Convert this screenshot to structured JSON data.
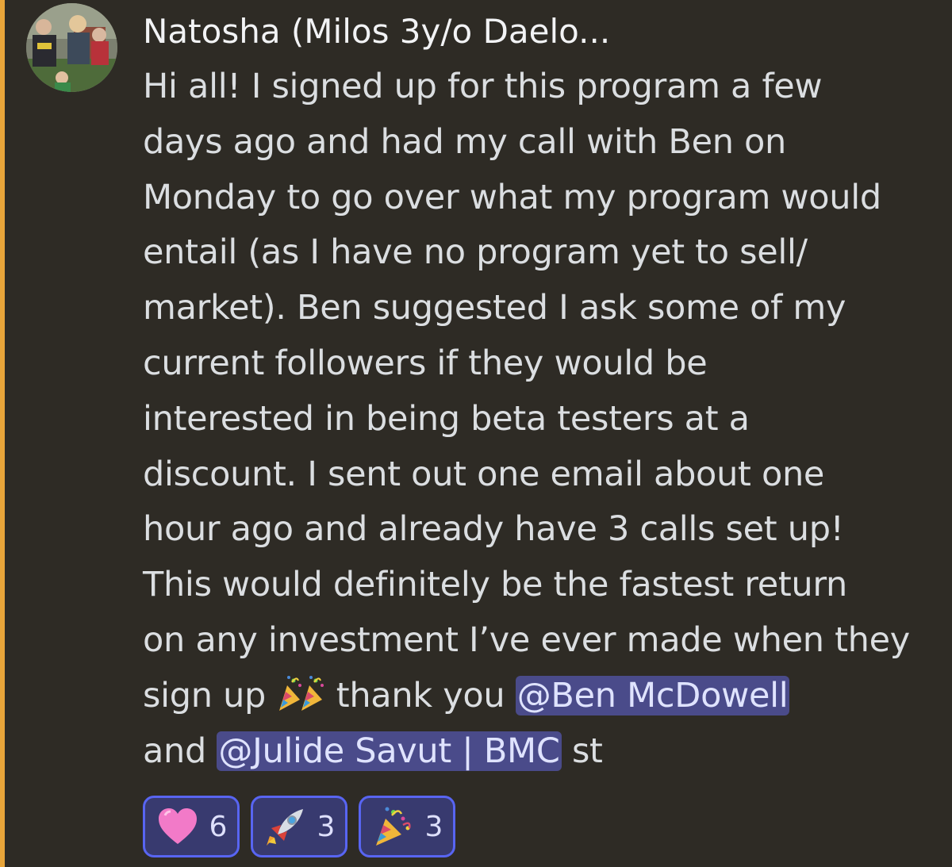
{
  "message": {
    "author": "Natosha (Milos 3y/o Daelo...",
    "lines": [
      "Hi all! I signed up for this program a few",
      "days ago and had my call with Ben on",
      "Monday to go over what my program would",
      "entail (as I have no program yet to sell/",
      "market). Ben suggested I ask some of my",
      "current followers if they would be",
      "interested in being beta testers at a",
      "discount. I sent out one email about one",
      "hour ago and already have 3 calls set up!",
      "This would definitely be the fastest return",
      "on any investment I’ve ever made when they"
    ],
    "line_12_prefix": "sign up ",
    "line_12_mid": " thank you ",
    "mention_1": "@Ben McDowell",
    "line_13_prefix": "and ",
    "mention_2": "@Julide Savut | BMC",
    "line_13_suffix": " st"
  },
  "reactions": [
    {
      "emoji": "pink-heart-icon",
      "count": "6"
    },
    {
      "emoji": "rocket-icon",
      "count": "3"
    },
    {
      "emoji": "party-popper-icon",
      "count": "3"
    }
  ],
  "colors": {
    "background": "#2e2b25",
    "mention_highlight_bar": "#e8a53a",
    "mention_pill": "#4a4b8a",
    "reaction_border": "#5865f2"
  }
}
